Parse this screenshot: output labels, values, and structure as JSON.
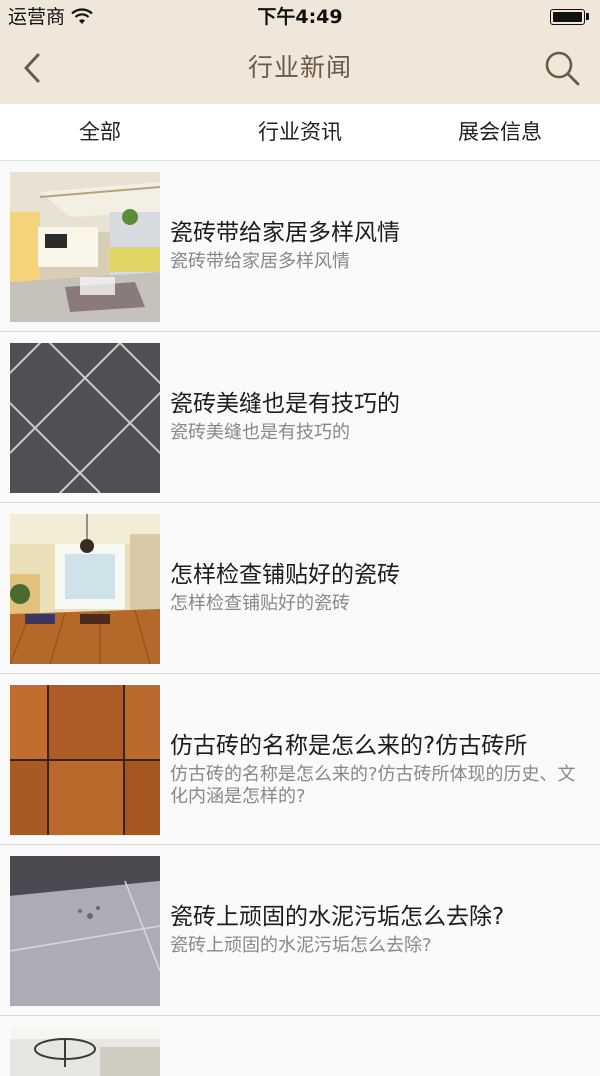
{
  "status_bar": {
    "carrier": "运营商",
    "time": "下午4:49"
  },
  "nav": {
    "title": "行业新闻"
  },
  "tabs": [
    "全部",
    "行业资讯",
    "展会信息"
  ],
  "articles": [
    {
      "title": "瓷砖带给家居多样风情",
      "summary": "瓷砖带给家居多样风情"
    },
    {
      "title": "瓷砖美缝也是有技巧的",
      "summary": "瓷砖美缝也是有技巧的"
    },
    {
      "title": "怎样检查铺贴好的瓷砖",
      "summary": "怎样检查铺贴好的瓷砖"
    },
    {
      "title": "仿古砖的名称是怎么来的?仿古砖所",
      "summary": "仿古砖的名称是怎么来的?仿古砖所体现的历史、文化内涵是怎样的?"
    },
    {
      "title": "瓷砖上顽固的水泥污垢怎么去除?",
      "summary": "瓷砖上顽固的水泥污垢怎么去除?"
    }
  ]
}
